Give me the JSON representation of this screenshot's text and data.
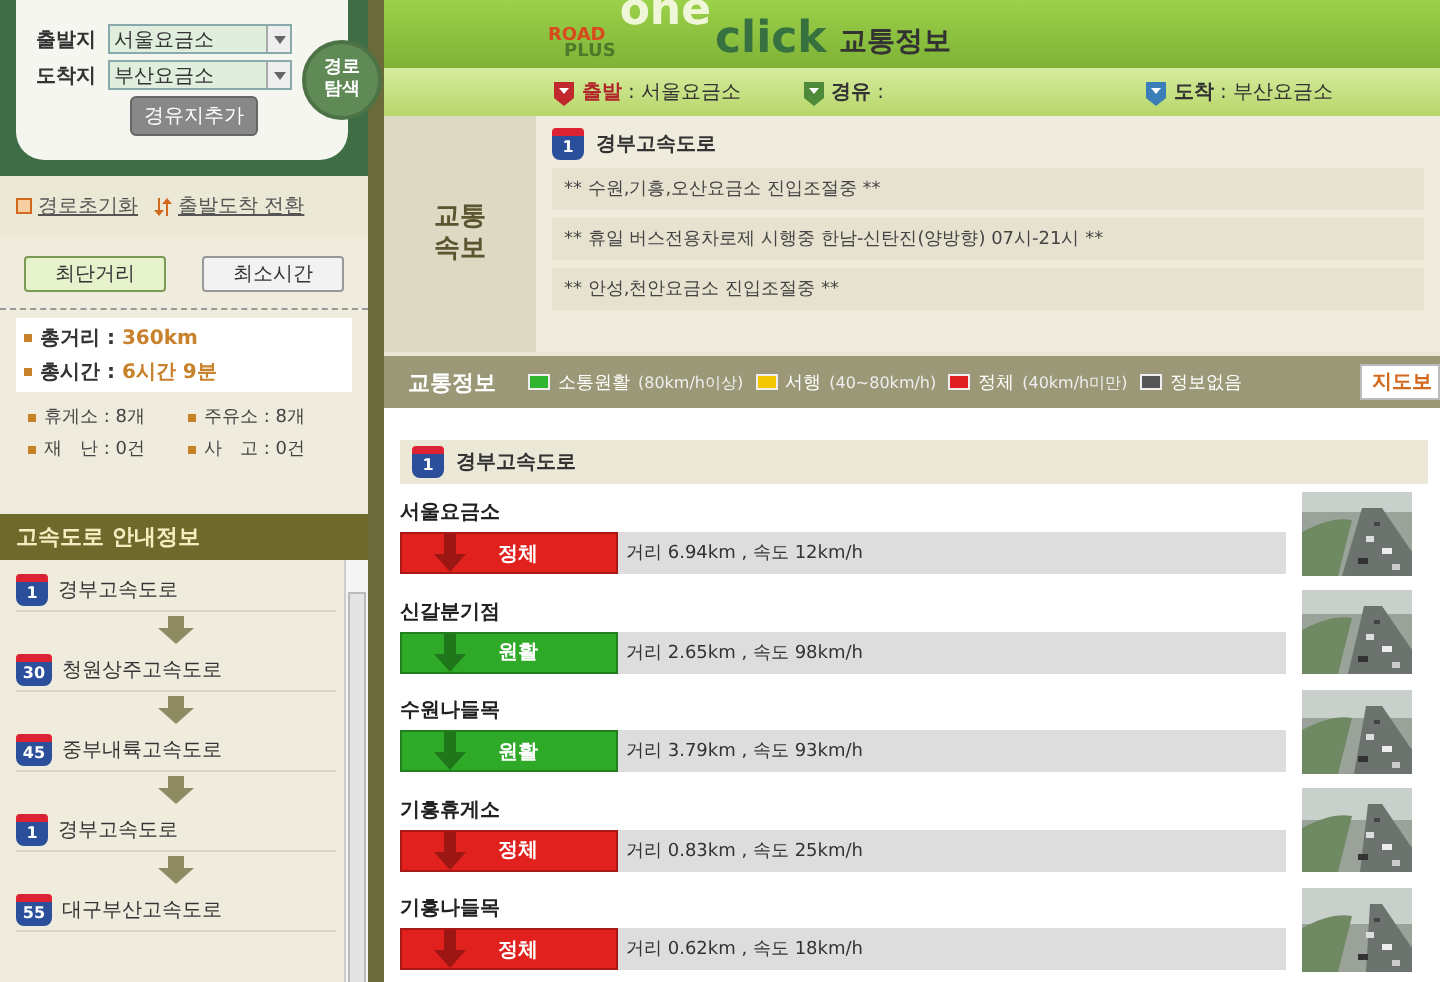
{
  "search": {
    "origin_label": "출발지",
    "origin_value": "서울요금소",
    "destination_label": "도착지",
    "destination_value": "부산요금소",
    "add_waypoint": "경유지추가",
    "search_button": "경로\n탐색"
  },
  "logo": {
    "road": "ROAD",
    "plus": "PLUS",
    "one": "one",
    "click": "click",
    "title": "교통정보"
  },
  "route_bar": [
    {
      "kind": "origin",
      "label": "출발",
      "value": ": 서울요금소"
    },
    {
      "kind": "waypoint",
      "label": "경유",
      "value": ":"
    },
    {
      "kind": "destination",
      "label": "도착",
      "value": ": 부산요금소"
    }
  ],
  "links": [
    {
      "kind": "reset",
      "label": "경로초기화"
    },
    {
      "kind": "swap",
      "label": "출발도착 전환"
    }
  ],
  "mode_tabs": [
    {
      "label": "최단거리",
      "selected": true
    },
    {
      "label": "최소시간",
      "selected": false
    }
  ],
  "summary": [
    {
      "label": "총거리 :",
      "value": "360km"
    },
    {
      "label": "총시간 :",
      "value": "6시간 9분"
    }
  ],
  "stats": [
    {
      "label": "휴게소 : 8개"
    },
    {
      "label": "주유소 : 8개"
    },
    {
      "label": "재　난 : 0건"
    },
    {
      "label": "사　고 : 0건"
    }
  ],
  "guide": {
    "title": "고속도로 안내정보",
    "routes": [
      {
        "number": "1",
        "name": "경부고속도로"
      },
      {
        "number": "30",
        "name": "청원상주고속도로"
      },
      {
        "number": "45",
        "name": "중부내륙고속도로"
      },
      {
        "number": "1",
        "name": "경부고속도로"
      },
      {
        "number": "55",
        "name": "대구부산고속도로"
      }
    ]
  },
  "bulletin": {
    "title": "교통\n속보",
    "road_number": "1",
    "road_name": "경부고속도로",
    "lines": [
      "** 수원,기흥,오산요금소 진입조절중 **",
      "** 휴일 버스전용차로제 시행중 한남-신탄진(양방향) 07시-21시 **",
      "** 안성,천안요금소 진입조절중 **"
    ]
  },
  "legend": {
    "title": "교통정보",
    "items": [
      {
        "color": "#2fb52f",
        "label": "소통원활",
        "note": "(80km/h이상)"
      },
      {
        "color": "#f2c600",
        "label": "서행",
        "note": "(40~80km/h)"
      },
      {
        "color": "#e02020",
        "label": "정체",
        "note": "(40km/h미만)"
      },
      {
        "color": "#555555",
        "label": "정보없음"
      }
    ],
    "map_button": "지도보"
  },
  "traffic": {
    "road_number": "1",
    "road_name": "경부고속도로",
    "rows": [
      {
        "name": "서울요금소",
        "kind": "congested",
        "status": "정체",
        "info": "거리 6.94km , 속도 12km/h"
      },
      {
        "name": "신갈분기점",
        "kind": "smooth",
        "status": "원활",
        "info": "거리 2.65km , 속도 98km/h"
      },
      {
        "name": "수원나들목",
        "kind": "smooth",
        "status": "원활",
        "info": "거리 3.79km , 속도 93km/h"
      },
      {
        "name": "기흥휴게소",
        "kind": "congested",
        "status": "정체",
        "info": "거리 0.83km , 속도 25km/h"
      },
      {
        "name": "기흥나들목",
        "kind": "congested",
        "status": "정체",
        "info": "거리 0.62km , 속도 18km/h"
      }
    ]
  }
}
